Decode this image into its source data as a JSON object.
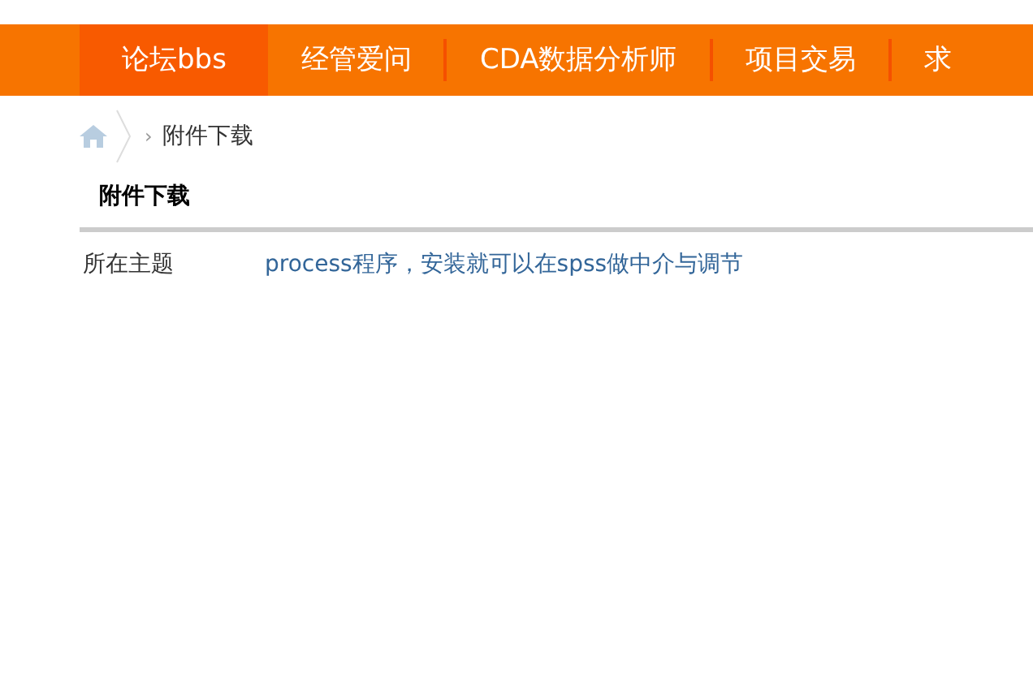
{
  "nav": [
    {
      "label": "论坛bbs",
      "selected": true
    },
    {
      "label": "经管爱问",
      "selected": false
    },
    {
      "label": "CDA数据分析师",
      "selected": false
    },
    {
      "label": "项目交易",
      "selected": false
    },
    {
      "label": "求",
      "selected": false
    }
  ],
  "breadcrumb": {
    "separator": "›",
    "current": "附件下载"
  },
  "section_title": "附件下载",
  "fields": [
    {
      "label": "所在主题",
      "value": "process程序，安装就可以在spss做中介与调节"
    }
  ]
}
